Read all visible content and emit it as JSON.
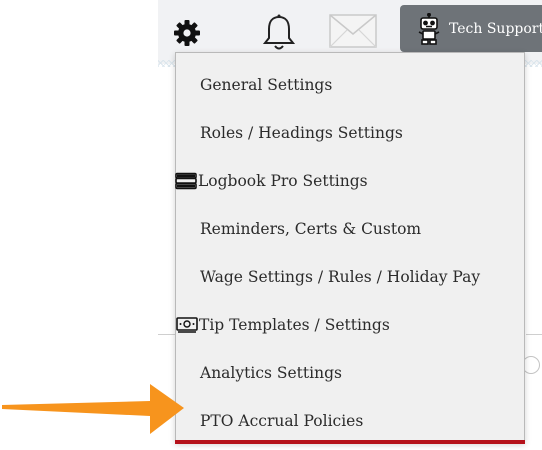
{
  "toolbar": {
    "gear_icon": "gear-icon",
    "bell_icon": "bell-icon",
    "mail_icon": "mail-icon",
    "support_icon": "robot-icon",
    "support_label": "Tech Support"
  },
  "settings_menu": {
    "items": [
      {
        "label": "General Settings",
        "icon": ""
      },
      {
        "label": "Roles / Headings Settings",
        "icon": ""
      },
      {
        "label": "Logbook Pro Settings",
        "icon": "book-stack-icon"
      },
      {
        "label": "Reminders, Certs & Custom",
        "icon": ""
      },
      {
        "label": "Wage Settings / Rules / Holiday Pay",
        "icon": ""
      },
      {
        "label": "Tip Templates / Settings",
        "icon": "cash-icon"
      },
      {
        "label": "Analytics Settings",
        "icon": ""
      },
      {
        "label": "PTO Accrual Policies",
        "icon": ""
      }
    ],
    "accent_color": "#b5121b"
  },
  "annotation": {
    "arrow_color": "#f7941d",
    "pointing_to": "PTO Accrual Policies"
  }
}
